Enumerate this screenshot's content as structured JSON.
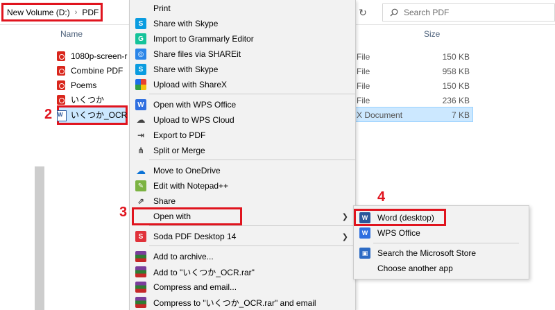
{
  "address": {
    "drive": "New Volume (D:)",
    "folder": "PDF",
    "search_placeholder": "Search PDF"
  },
  "columns": {
    "name": "Name",
    "size": "Size"
  },
  "files": [
    {
      "name": "1080p-screen-r",
      "type": "File",
      "size": "150 KB",
      "icon": "pdf-icon"
    },
    {
      "name": "Combine PDF",
      "type": "File",
      "size": "958 KB",
      "icon": "pdf-icon"
    },
    {
      "name": "Poems",
      "type": "File",
      "size": "150 KB",
      "icon": "pdf-icon"
    },
    {
      "name": "いくつか",
      "type": "File",
      "size": "236 KB",
      "icon": "pdf-icon"
    },
    {
      "name": "いくつか_OCR",
      "type": "X Document",
      "size": "7 KB",
      "icon": "word-doc-icon"
    }
  ],
  "steps": [
    "2",
    "3",
    "4"
  ],
  "context_menu": [
    {
      "label": "Print",
      "icon": ""
    },
    {
      "label": "Share with Skype",
      "icon": "skype-icon"
    },
    {
      "label": "Import to Grammarly Editor",
      "icon": "grammarly-icon"
    },
    {
      "label": "Share files via SHAREit",
      "icon": "shareit-icon"
    },
    {
      "label": "Share with Skype",
      "icon": "skype-icon"
    },
    {
      "label": "Upload with ShareX",
      "icon": "sharex-icon"
    },
    {
      "label": "Open with WPS Office",
      "icon": "wps-icon"
    },
    {
      "label": "Upload to WPS Cloud",
      "icon": "cloud-icon"
    },
    {
      "label": "Export to PDF",
      "icon": "export-pdf-icon"
    },
    {
      "label": "Split or Merge",
      "icon": "split-icon"
    },
    {
      "label": "Move to OneDrive",
      "icon": "onedrive-icon"
    },
    {
      "label": "Edit with Notepad++",
      "icon": "notepad-icon"
    },
    {
      "label": "Share",
      "icon": "share-icon"
    },
    {
      "label": "Open with",
      "icon": ""
    },
    {
      "label": "Soda PDF Desktop 14",
      "icon": "soda-pdf-icon"
    },
    {
      "label": "Add to archive...",
      "icon": "winrar-icon"
    },
    {
      "label": "Add to \"いくつか_OCR.rar\"",
      "icon": "winrar-icon"
    },
    {
      "label": "Compress and email...",
      "icon": "winrar-icon"
    },
    {
      "label": "Compress to \"いくつか_OCR.rar\" and email",
      "icon": "winrar-icon"
    }
  ],
  "submenu": [
    {
      "label": "Word (desktop)",
      "icon": "word-icon"
    },
    {
      "label": "WPS Office",
      "icon": "wps-office-icon"
    },
    {
      "label": "Search the Microsoft Store",
      "icon": "store-icon"
    },
    {
      "label": "Choose another app",
      "icon": ""
    }
  ],
  "colors": {
    "highlight": "#e0141e",
    "selection": "#cce8ff"
  }
}
